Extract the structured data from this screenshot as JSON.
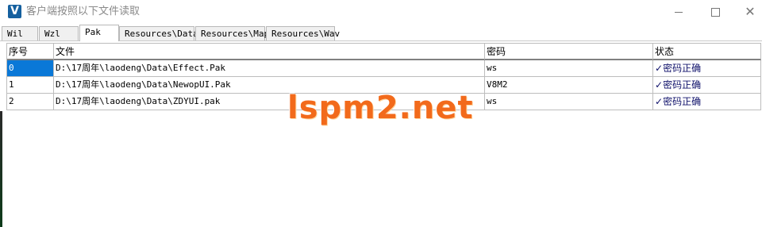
{
  "window": {
    "title": "客户端按照以下文件读取",
    "icon_letter": "V",
    "accent": "#15609f"
  },
  "tabs": [
    {
      "label": "Wil"
    },
    {
      "label": "Wzl"
    },
    {
      "label": "Pak",
      "active": true
    },
    {
      "label": "Resources\\Data"
    },
    {
      "label": "Resources\\Map"
    },
    {
      "label": "Resources\\Wav"
    }
  ],
  "table": {
    "headers": [
      "序号",
      "文件",
      "密码",
      "状态"
    ],
    "rows": [
      {
        "index": "0",
        "file": "D:\\17周年\\laodeng\\Data\\Effect.Pak",
        "password": "ws",
        "status_check": "✓",
        "status": "密码正确"
      },
      {
        "index": "1",
        "file": "D:\\17周年\\laodeng\\Data\\NewopUI.Pak",
        "password": "V8M2",
        "status_check": "✓",
        "status": "密码正确"
      },
      {
        "index": "2",
        "file": "D:\\17周年\\laodeng\\Data\\ZDYUI.pak",
        "password": "ws",
        "status_check": "✓",
        "status": "密码正确"
      }
    ]
  },
  "watermark": {
    "text": "lspm2.net",
    "color": "#f26a1b"
  },
  "colors": {
    "selection": "#0a78d7",
    "status_text": "#10126b"
  }
}
